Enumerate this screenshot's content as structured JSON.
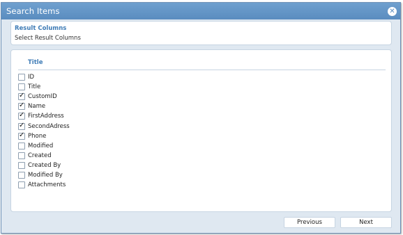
{
  "dialog": {
    "title": "Search Items",
    "close_glyph": "✕"
  },
  "result_columns": {
    "heading": "Result Columns",
    "subtitle": "Select Result Columns"
  },
  "columns": {
    "header": "Title",
    "items": [
      {
        "label": "ID",
        "checked": false
      },
      {
        "label": "Title",
        "checked": false
      },
      {
        "label": "CustomID",
        "checked": true
      },
      {
        "label": "Name",
        "checked": true
      },
      {
        "label": "FirstAddress",
        "checked": true
      },
      {
        "label": "SecondAdress",
        "checked": true
      },
      {
        "label": "Phone",
        "checked": true
      },
      {
        "label": "Modified",
        "checked": false
      },
      {
        "label": "Created",
        "checked": false
      },
      {
        "label": "Created By",
        "checked": false
      },
      {
        "label": "Modified By",
        "checked": false
      },
      {
        "label": "Attachments",
        "checked": false
      }
    ]
  },
  "footer": {
    "previous_label": "Previous",
    "next_label": "Next"
  },
  "colors": {
    "titlebar": "#5a8cbf",
    "heading_blue": "#3f7cb6",
    "dialog_bg": "#dfe8f1"
  }
}
